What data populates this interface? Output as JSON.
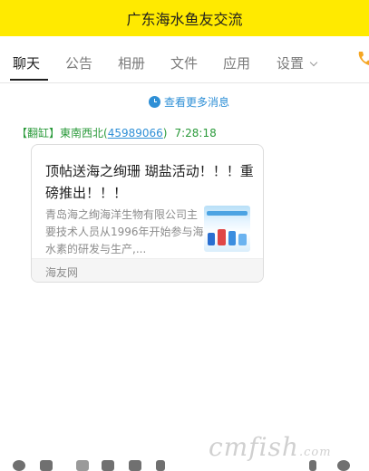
{
  "window": {
    "title": "广东海水鱼友交流"
  },
  "tabs": [
    {
      "label": "聊天",
      "active": true
    },
    {
      "label": "公告"
    },
    {
      "label": "相册"
    },
    {
      "label": "文件"
    },
    {
      "label": "应用"
    },
    {
      "label": "设置"
    }
  ],
  "toolbar_icons": [
    "phone-icon"
  ],
  "chat": {
    "more_messages": "查看更多消息",
    "messages": [
      {
        "rank_tag": "【翻缸】",
        "sender_name": "東南西北",
        "sender_id": "45989066",
        "time": "7:28:18",
        "card": {
          "title": "顶帖送海之绚珊 瑚盐活动！！！重磅推出！！！",
          "description": "青岛海之绚海洋生物有限公司主要技术人员从1996年开始参与海水素的研发与生产,...",
          "source": "海友网"
        }
      }
    ]
  },
  "watermark": {
    "text": "cmfish",
    "suffix": ".com"
  },
  "colors": {
    "titlebar": "#ffea00",
    "link": "#2e8fd6",
    "sender": "#2a9a3a",
    "phone_icon": "#f5a623"
  }
}
